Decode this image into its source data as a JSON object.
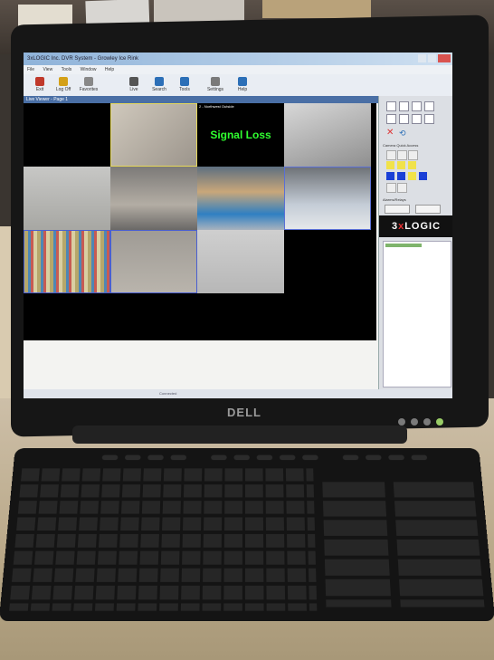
{
  "app": {
    "title": "3xLOGIC Inc. DVR System - Growley Ice Rink",
    "menu": [
      "File",
      "View",
      "Tools",
      "Window",
      "Help"
    ],
    "toolbar": [
      {
        "label": "Exit",
        "color": "#c0392b"
      },
      {
        "label": "Log Off",
        "color": "#d4a017"
      },
      {
        "label": "Favorites",
        "color": "#888"
      },
      {
        "label": "Live",
        "color": "#555"
      },
      {
        "label": "Search",
        "color": "#2c6fb7"
      },
      {
        "label": "Tools",
        "color": "#2c6fb7"
      },
      {
        "label": "Settings",
        "color": "#7a7a7a"
      },
      {
        "label": "Help",
        "color": "#2c6fb7"
      }
    ],
    "viewer_title": "Live Viewer - Page 1",
    "cameras": [
      {
        "label": "",
        "color": "#000000"
      },
      {
        "label": "",
        "color": "#b0aaa2"
      },
      {
        "label": "2 - Northwest Outside",
        "color": "#000000"
      },
      {
        "label": "",
        "color": "#a9a9a9"
      },
      {
        "label": "",
        "color": "#b8b8b4"
      },
      {
        "label": "",
        "color": "#8c8a86"
      },
      {
        "label": "",
        "color": "#5f88a8"
      },
      {
        "label": "",
        "color": "#9aa7b5"
      },
      {
        "label": "",
        "color": "#c9b58a"
      },
      {
        "label": "",
        "color": "#9e9a94"
      },
      {
        "label": "",
        "color": "#c4c4c4"
      },
      {
        "label": "",
        "color": "#000000"
      }
    ],
    "signal_text": "Signal Loss",
    "panel": {
      "quick_access_label": "Camera Quick Access",
      "alarms_label": "Alarms/Relays",
      "logo_prefix": "3",
      "logo_x": "x",
      "logo_suffix": "LOGIC"
    },
    "status_bar": "Connected"
  },
  "monitor": {
    "brand": "DELL"
  },
  "colors": {
    "accent": "#4a6fa5",
    "signal": "#30ff30",
    "logo_red": "#e83030"
  }
}
